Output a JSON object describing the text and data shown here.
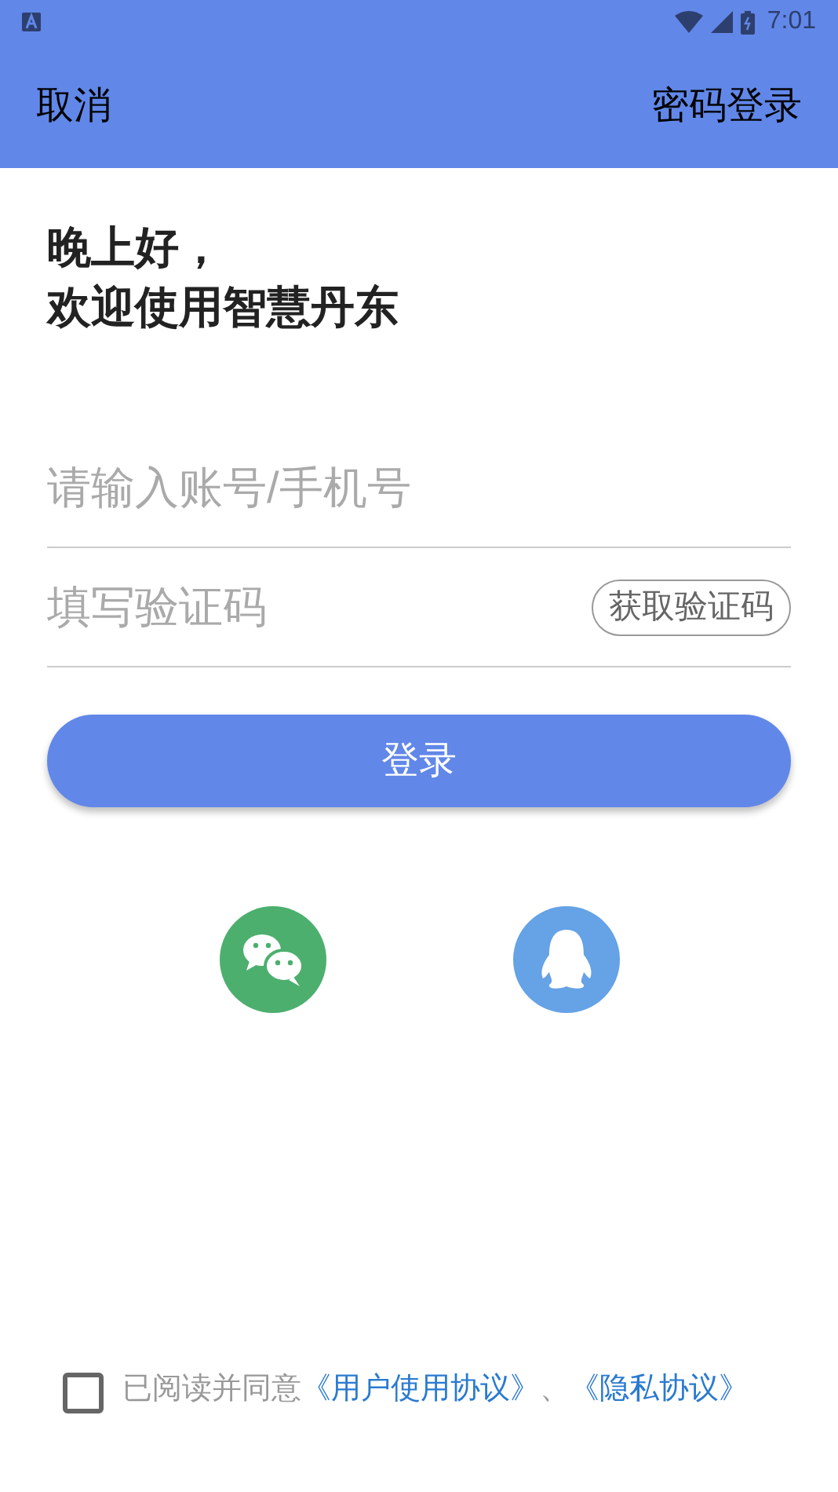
{
  "status_bar": {
    "time": "7:01"
  },
  "app_bar": {
    "left": "取消",
    "right": "密码登录"
  },
  "greeting": [
    "晚上好，",
    "欢迎使用智慧丹东"
  ],
  "fields": [
    {
      "kind": "text",
      "placeholder": "请输入账号/手机号"
    },
    {
      "kind": "code",
      "placeholder": "填写验证码",
      "action": "获取验证码"
    }
  ],
  "login_button": "登录",
  "agreement": {
    "checked": false,
    "parts": [
      {
        "kind": "text",
        "text": "已阅读并同意"
      },
      {
        "kind": "link",
        "text": "《用户使用协议》"
      },
      {
        "kind": "text",
        "text": "、"
      },
      {
        "kind": "link",
        "text": "《隐私协议》"
      }
    ]
  }
}
